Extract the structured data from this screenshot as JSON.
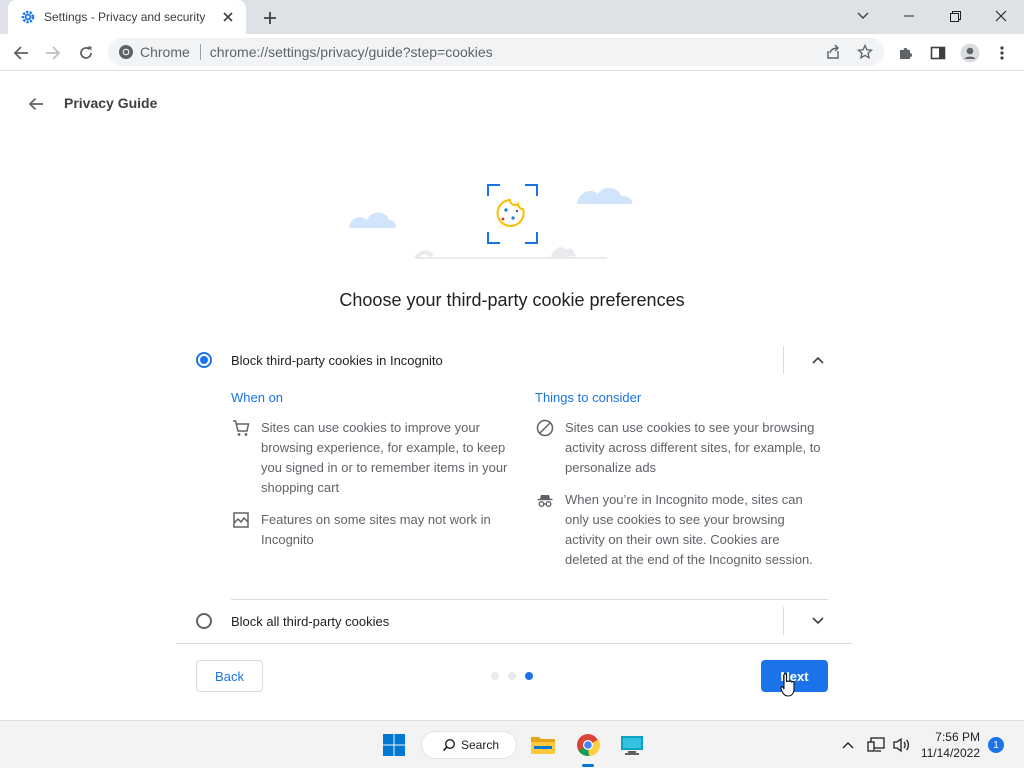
{
  "window": {
    "tab_title": "Settings - Privacy and security",
    "accent": "#1a73e8"
  },
  "toolbar": {
    "site_label": "Chrome",
    "url": "chrome://settings/privacy/guide?step=cookies"
  },
  "page": {
    "title": "Privacy Guide",
    "heading": "Choose your third-party cookie preferences"
  },
  "options": [
    {
      "label": "Block third-party cookies in Incognito",
      "selected": true,
      "expanded": true,
      "when_on_title": "When on",
      "when_on": [
        {
          "icon": "cart-icon",
          "text": "Sites can use cookies to improve your browsing experience, for example, to keep you signed in or to remember items in your shopping cart"
        },
        {
          "icon": "broken-image-icon",
          "text": "Features on some sites may not work in Incognito"
        }
      ],
      "consider_title": "Things to consider",
      "consider": [
        {
          "icon": "block-icon",
          "text": "Sites can use cookies to see your browsing activity across different sites, for example, to personalize ads"
        },
        {
          "icon": "incognito-icon",
          "text": "When you’re in Incognito mode, sites can only use cookies to see your browsing activity on their own site. Cookies are deleted at the end of the Incognito session."
        }
      ]
    },
    {
      "label": "Block all third-party cookies",
      "selected": false,
      "expanded": false
    }
  ],
  "footer": {
    "back_label": "Back",
    "next_label": "Next",
    "steps_total": 3,
    "step_current": 3
  },
  "taskbar": {
    "search_label": "Search",
    "time": "7:56 PM",
    "date": "11/14/2022",
    "notification_count": "1"
  }
}
